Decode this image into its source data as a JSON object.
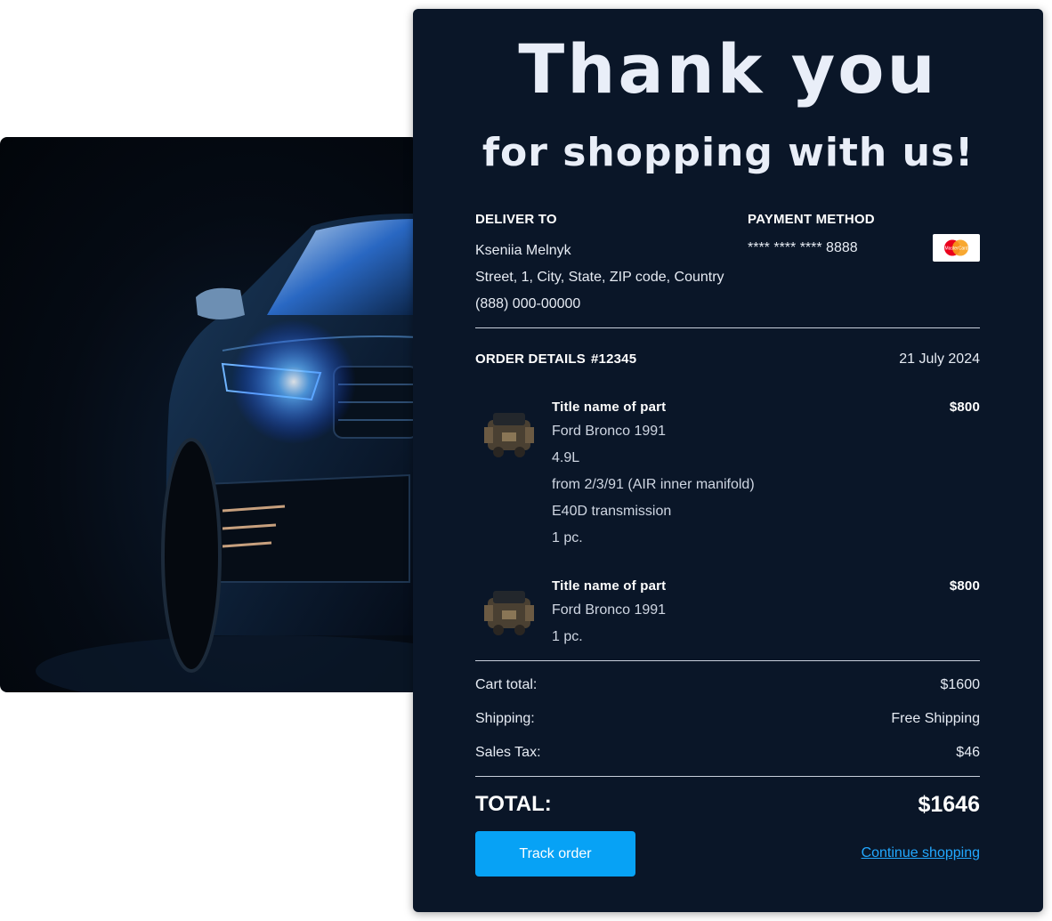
{
  "hero": {
    "line1": "Thank you",
    "line2": "for shopping with us!"
  },
  "delivery": {
    "heading": "DELIVER TO",
    "name": "Kseniia Melnyk",
    "address": "Street, 1, City, State, ZIP code, Country",
    "phone": "(888) 000-00000"
  },
  "payment": {
    "heading": "PAYMENT METHOD",
    "card_number": "**** **** **** 8888",
    "card_brand": "mastercard-icon",
    "card_logo_text": "MasterCard"
  },
  "order": {
    "heading": "ORDER DETAILS",
    "number": "#12345",
    "date": "21 July 2024",
    "items": [
      {
        "title": "Title name of part",
        "price": "$800",
        "details": [
          "Ford Bronco 1991",
          "4.9L",
          "from 2/3/91 (AIR inner manifold)",
          "E40D transmission"
        ],
        "qty": "1 pc."
      },
      {
        "title": "Title name of part",
        "price": "$800",
        "details": [
          "Ford Bronco 1991"
        ],
        "qty": "1 pc."
      }
    ]
  },
  "summary": {
    "cart_total_label": "Cart total:",
    "cart_total_value": "$1600",
    "shipping_label": "Shipping:",
    "shipping_value": "Free Shipping",
    "tax_label": "Sales Tax:",
    "tax_value": "$46",
    "total_label": "TOTAL:",
    "total_value": "$1646"
  },
  "actions": {
    "track_label": "Track order",
    "continue_label": "Continue shopping"
  },
  "colors": {
    "panel_bg": "#0a1628",
    "accent": "#07a2f5",
    "link": "#22a8ff"
  }
}
